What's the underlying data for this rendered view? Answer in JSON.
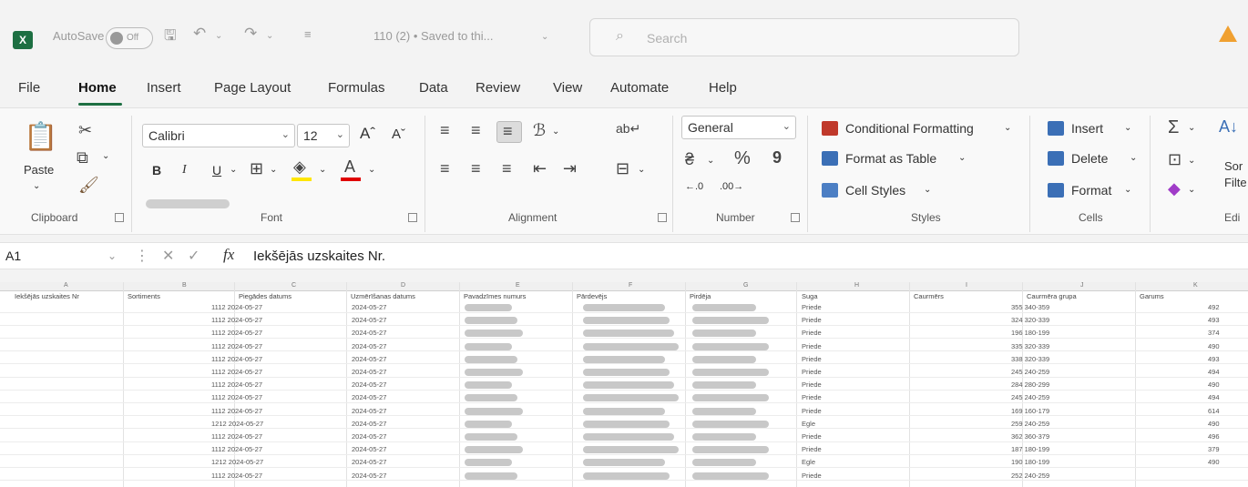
{
  "titlebar": {
    "app_icon": "excel-icon",
    "autosave_label": "AutoSave",
    "autosave_state": "Off",
    "file_title": "110 (2) • Saved to thi...",
    "search_placeholder": "Search"
  },
  "menu": {
    "tabs": [
      {
        "label": "File"
      },
      {
        "label": "Home"
      },
      {
        "label": "Insert"
      },
      {
        "label": "Page Layout"
      },
      {
        "label": "Formulas"
      },
      {
        "label": "Data"
      },
      {
        "label": "Review"
      },
      {
        "label": "View"
      },
      {
        "label": "Automate"
      },
      {
        "label": "Help"
      }
    ],
    "active": "Home"
  },
  "ribbon": {
    "clipboard": {
      "label": "Clipboard",
      "paste": "Paste"
    },
    "font": {
      "label": "Font",
      "font_name": "Calibri",
      "font_size": "12",
      "bold": "B",
      "italic": "I",
      "underline": "U"
    },
    "alignment": {
      "label": "Alignment"
    },
    "number": {
      "label": "Number",
      "format": "General",
      "percent": "%",
      "comma": "9"
    },
    "styles": {
      "label": "Styles",
      "conditional": "Conditional Formatting",
      "table": "Format as Table",
      "cell_styles": "Cell Styles"
    },
    "cells": {
      "label": "Cells",
      "insert": "Insert",
      "delete": "Delete",
      "format": "Format"
    },
    "editing": {
      "label": "Edi",
      "sort": "Sor",
      "filter": "Filte"
    }
  },
  "formula_bar": {
    "name_box": "A1",
    "fx": "fx",
    "content": "Iekšējās uzskaites Nr."
  },
  "sheet": {
    "columns": [
      "A",
      "B",
      "C",
      "D",
      "E",
      "F",
      "G",
      "H",
      "I",
      "J",
      "K"
    ],
    "headers": [
      "Iekšējās uzskaites Nr",
      "Sortiments",
      "Piegādes datums",
      "Uzmērīšanas datums",
      "Pavadzīmes numurs",
      "Pārdevējs",
      "Pirdēja",
      "Suga",
      "Caurmērs",
      "Caurmēra grupa",
      "Garums"
    ],
    "rows": [
      {
        "c": "1112 2024-05-27",
        "d": "2024-05-27",
        "h": "Priede",
        "j": "355 340-359",
        "k": "492"
      },
      {
        "c": "1112 2024-05-27",
        "d": "2024-05-27",
        "h": "Priede",
        "j": "324 320-339",
        "k": "493"
      },
      {
        "c": "1112 2024-05-27",
        "d": "2024-05-27",
        "h": "Priede",
        "j": "196 180-199",
        "k": "374"
      },
      {
        "c": "1112 2024-05-27",
        "d": "2024-05-27",
        "h": "Priede",
        "j": "335 320-339",
        "k": "490"
      },
      {
        "c": "1112 2024-05-27",
        "d": "2024-05-27",
        "h": "Priede",
        "j": "338 320-339",
        "k": "493"
      },
      {
        "c": "1112 2024-05-27",
        "d": "2024-05-27",
        "h": "Priede",
        "j": "245 240-259",
        "k": "494"
      },
      {
        "c": "1112 2024-05-27",
        "d": "2024-05-27",
        "h": "Priede",
        "j": "284 280-299",
        "k": "490"
      },
      {
        "c": "1112 2024-05-27",
        "d": "2024-05-27",
        "h": "Priede",
        "j": "245 240-259",
        "k": "494"
      },
      {
        "c": "1112 2024-05-27",
        "d": "2024-05-27",
        "h": "Priede",
        "j": "169 160-179",
        "k": "614"
      },
      {
        "c": "1212 2024-05-27",
        "d": "2024-05-27",
        "h": "Egle",
        "j": "259 240-259",
        "k": "490"
      },
      {
        "c": "1112 2024-05-27",
        "d": "2024-05-27",
        "h": "Priede",
        "j": "362 360-379",
        "k": "496"
      },
      {
        "c": "1112 2024-05-27",
        "d": "2024-05-27",
        "h": "Priede",
        "j": "187 180-199",
        "k": "379"
      },
      {
        "c": "1212 2024-05-27",
        "d": "2024-05-27",
        "h": "Egle",
        "j": "190 180-199",
        "k": "490"
      },
      {
        "c": "1112 2024-05-27",
        "d": "2024-05-27",
        "h": "Priede",
        "j": "252 240-259",
        "k": ""
      }
    ]
  }
}
